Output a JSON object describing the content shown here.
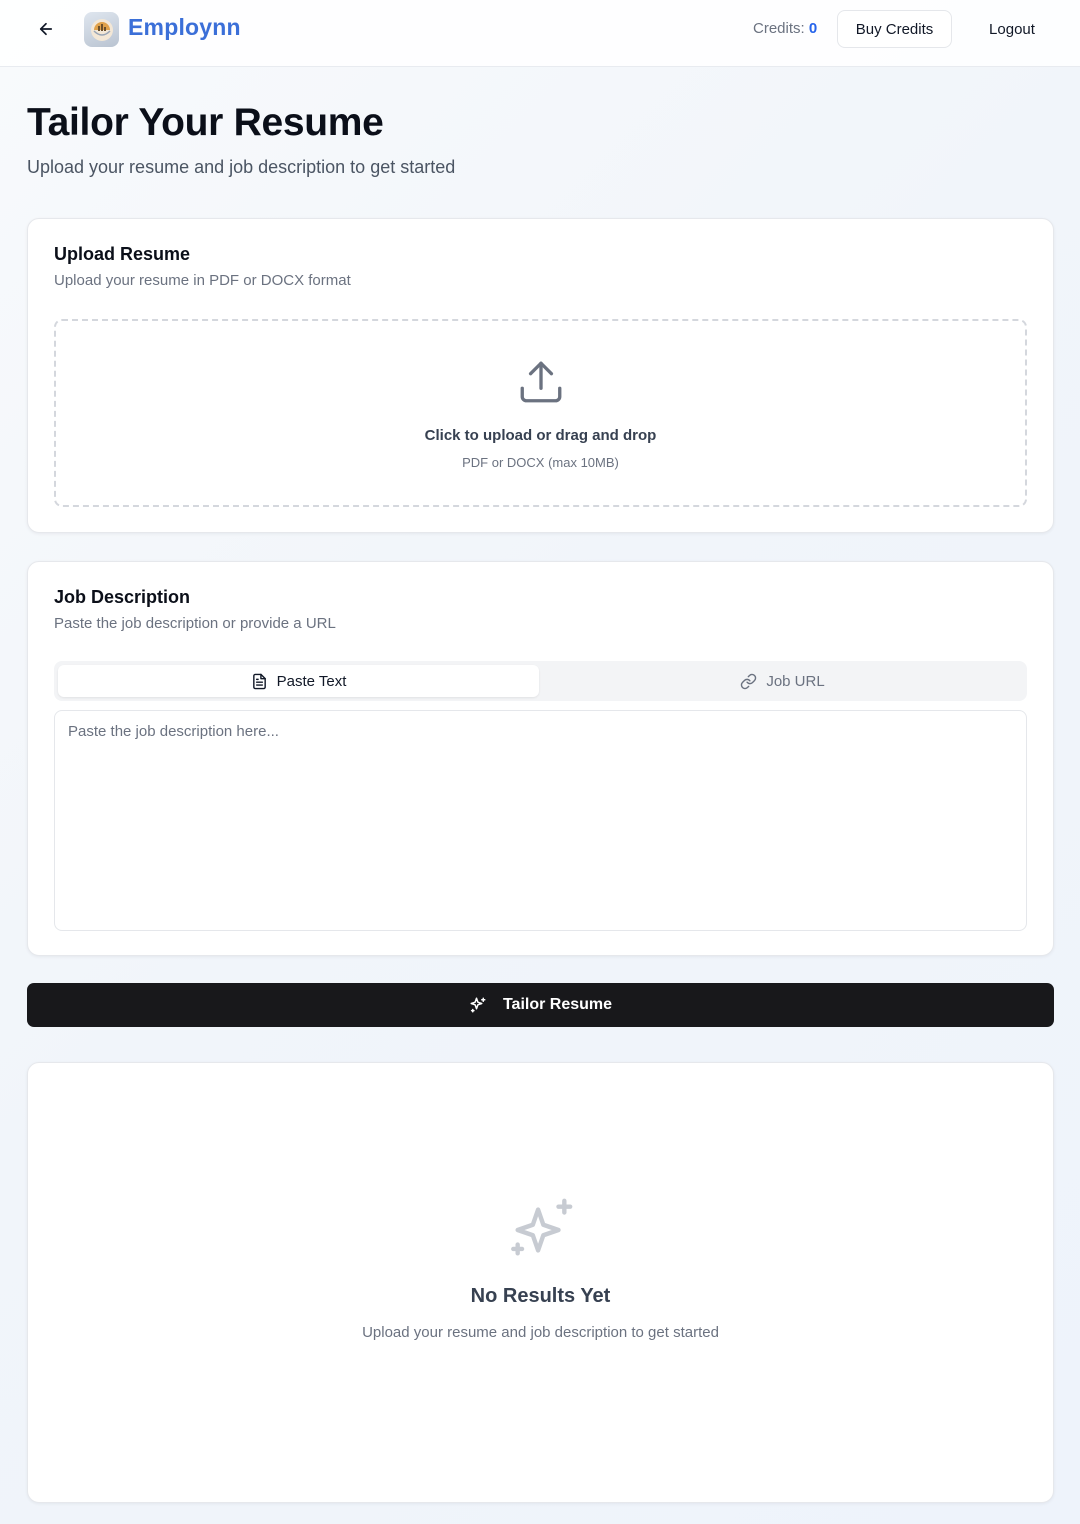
{
  "header": {
    "brand": "Employnn",
    "credits_label": "Credits:",
    "credits_value": "0",
    "buy_credits": "Buy Credits",
    "logout": "Logout"
  },
  "page": {
    "title": "Tailor Your Resume",
    "subtitle": "Upload your resume and job description to get started"
  },
  "upload": {
    "title": "Upload Resume",
    "description": "Upload your resume in PDF or DOCX format",
    "dropzone_main": "Click to upload or drag and drop",
    "dropzone_sub": "PDF or DOCX (max 10MB)"
  },
  "job": {
    "title": "Job Description",
    "description": "Paste the job description or provide a URL",
    "tabs": [
      {
        "label": "Paste Text",
        "icon": "file-text-icon",
        "active": true
      },
      {
        "label": "Job URL",
        "icon": "link-icon",
        "active": false
      }
    ],
    "textarea_value": "",
    "textarea_placeholder": "Paste the job description here..."
  },
  "action": {
    "tailor_label": "Tailor Resume",
    "icon": "sparkles-icon"
  },
  "results": {
    "title": "No Results Yet",
    "subtitle": "Upload your resume and job description to get started"
  },
  "colors": {
    "brand": "#3b6fd8",
    "credits": "#2563eb",
    "primary_button": "#18181b"
  }
}
